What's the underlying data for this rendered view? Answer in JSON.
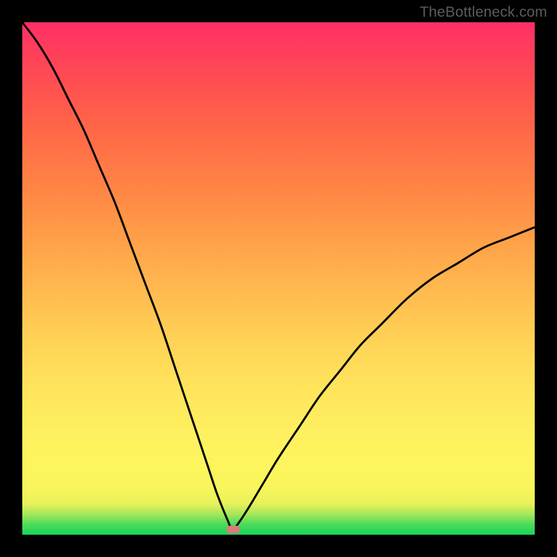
{
  "watermark": "TheBottleneck.com",
  "colors": {
    "frame": "#000000",
    "curve": "#000000",
    "marker": "#d57f7a"
  },
  "chart_data": {
    "type": "line",
    "title": "",
    "xlabel": "",
    "ylabel": "",
    "xlim": [
      0,
      100
    ],
    "ylim": [
      0,
      100
    ],
    "grid": false,
    "notes": "Bottleneck-style curve: y% approaches 0 at the matched point and rises steeply to either side. Left branch starts near top-left corner; right branch exits near the right edge around y≈60. Minimum sits near x≈41.",
    "series": [
      {
        "name": "bottleneck-curve",
        "x": [
          0,
          3,
          6,
          9,
          12,
          15,
          18,
          21,
          24,
          27,
          30,
          33,
          36,
          38,
          40,
          41,
          42,
          44,
          47,
          50,
          54,
          58,
          62,
          66,
          70,
          75,
          80,
          85,
          90,
          95,
          100
        ],
        "y": [
          100,
          96,
          91,
          85,
          79,
          72,
          65,
          57,
          49,
          41,
          32,
          23,
          14,
          8,
          3,
          1,
          2,
          5,
          10,
          15,
          21,
          27,
          32,
          37,
          41,
          46,
          50,
          53,
          56,
          58,
          60
        ]
      }
    ],
    "marker": {
      "x": 41.2,
      "y": 1.0
    }
  }
}
